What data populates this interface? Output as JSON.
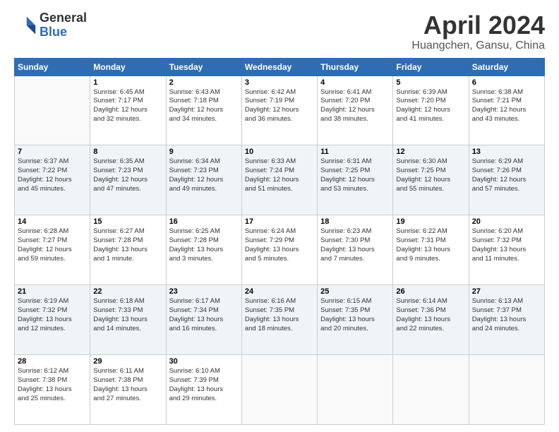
{
  "header": {
    "logo_general": "General",
    "logo_blue": "Blue",
    "title": "April 2024",
    "location": "Huangchen, Gansu, China"
  },
  "weekdays": [
    "Sunday",
    "Monday",
    "Tuesday",
    "Wednesday",
    "Thursday",
    "Friday",
    "Saturday"
  ],
  "weeks": [
    [
      {
        "day": "",
        "info": ""
      },
      {
        "day": "1",
        "info": "Sunrise: 6:45 AM\nSunset: 7:17 PM\nDaylight: 12 hours\nand 32 minutes."
      },
      {
        "day": "2",
        "info": "Sunrise: 6:43 AM\nSunset: 7:18 PM\nDaylight: 12 hours\nand 34 minutes."
      },
      {
        "day": "3",
        "info": "Sunrise: 6:42 AM\nSunset: 7:19 PM\nDaylight: 12 hours\nand 36 minutes."
      },
      {
        "day": "4",
        "info": "Sunrise: 6:41 AM\nSunset: 7:20 PM\nDaylight: 12 hours\nand 38 minutes."
      },
      {
        "day": "5",
        "info": "Sunrise: 6:39 AM\nSunset: 7:20 PM\nDaylight: 12 hours\nand 41 minutes."
      },
      {
        "day": "6",
        "info": "Sunrise: 6:38 AM\nSunset: 7:21 PM\nDaylight: 12 hours\nand 43 minutes."
      }
    ],
    [
      {
        "day": "7",
        "info": "Sunrise: 6:37 AM\nSunset: 7:22 PM\nDaylight: 12 hours\nand 45 minutes."
      },
      {
        "day": "8",
        "info": "Sunrise: 6:35 AM\nSunset: 7:23 PM\nDaylight: 12 hours\nand 47 minutes."
      },
      {
        "day": "9",
        "info": "Sunrise: 6:34 AM\nSunset: 7:23 PM\nDaylight: 12 hours\nand 49 minutes."
      },
      {
        "day": "10",
        "info": "Sunrise: 6:33 AM\nSunset: 7:24 PM\nDaylight: 12 hours\nand 51 minutes."
      },
      {
        "day": "11",
        "info": "Sunrise: 6:31 AM\nSunset: 7:25 PM\nDaylight: 12 hours\nand 53 minutes."
      },
      {
        "day": "12",
        "info": "Sunrise: 6:30 AM\nSunset: 7:25 PM\nDaylight: 12 hours\nand 55 minutes."
      },
      {
        "day": "13",
        "info": "Sunrise: 6:29 AM\nSunset: 7:26 PM\nDaylight: 12 hours\nand 57 minutes."
      }
    ],
    [
      {
        "day": "14",
        "info": "Sunrise: 6:28 AM\nSunset: 7:27 PM\nDaylight: 12 hours\nand 59 minutes."
      },
      {
        "day": "15",
        "info": "Sunrise: 6:27 AM\nSunset: 7:28 PM\nDaylight: 13 hours\nand 1 minute."
      },
      {
        "day": "16",
        "info": "Sunrise: 6:25 AM\nSunset: 7:28 PM\nDaylight: 13 hours\nand 3 minutes."
      },
      {
        "day": "17",
        "info": "Sunrise: 6:24 AM\nSunset: 7:29 PM\nDaylight: 13 hours\nand 5 minutes."
      },
      {
        "day": "18",
        "info": "Sunrise: 6:23 AM\nSunset: 7:30 PM\nDaylight: 13 hours\nand 7 minutes."
      },
      {
        "day": "19",
        "info": "Sunrise: 6:22 AM\nSunset: 7:31 PM\nDaylight: 13 hours\nand 9 minutes."
      },
      {
        "day": "20",
        "info": "Sunrise: 6:20 AM\nSunset: 7:32 PM\nDaylight: 13 hours\nand 11 minutes."
      }
    ],
    [
      {
        "day": "21",
        "info": "Sunrise: 6:19 AM\nSunset: 7:32 PM\nDaylight: 13 hours\nand 12 minutes."
      },
      {
        "day": "22",
        "info": "Sunrise: 6:18 AM\nSunset: 7:33 PM\nDaylight: 13 hours\nand 14 minutes."
      },
      {
        "day": "23",
        "info": "Sunrise: 6:17 AM\nSunset: 7:34 PM\nDaylight: 13 hours\nand 16 minutes."
      },
      {
        "day": "24",
        "info": "Sunrise: 6:16 AM\nSunset: 7:35 PM\nDaylight: 13 hours\nand 18 minutes."
      },
      {
        "day": "25",
        "info": "Sunrise: 6:15 AM\nSunset: 7:35 PM\nDaylight: 13 hours\nand 20 minutes."
      },
      {
        "day": "26",
        "info": "Sunrise: 6:14 AM\nSunset: 7:36 PM\nDaylight: 13 hours\nand 22 minutes."
      },
      {
        "day": "27",
        "info": "Sunrise: 6:13 AM\nSunset: 7:37 PM\nDaylight: 13 hours\nand 24 minutes."
      }
    ],
    [
      {
        "day": "28",
        "info": "Sunrise: 6:12 AM\nSunset: 7:38 PM\nDaylight: 13 hours\nand 25 minutes."
      },
      {
        "day": "29",
        "info": "Sunrise: 6:11 AM\nSunset: 7:38 PM\nDaylight: 13 hours\nand 27 minutes."
      },
      {
        "day": "30",
        "info": "Sunrise: 6:10 AM\nSunset: 7:39 PM\nDaylight: 13 hours\nand 29 minutes."
      },
      {
        "day": "",
        "info": ""
      },
      {
        "day": "",
        "info": ""
      },
      {
        "day": "",
        "info": ""
      },
      {
        "day": "",
        "info": ""
      }
    ]
  ]
}
